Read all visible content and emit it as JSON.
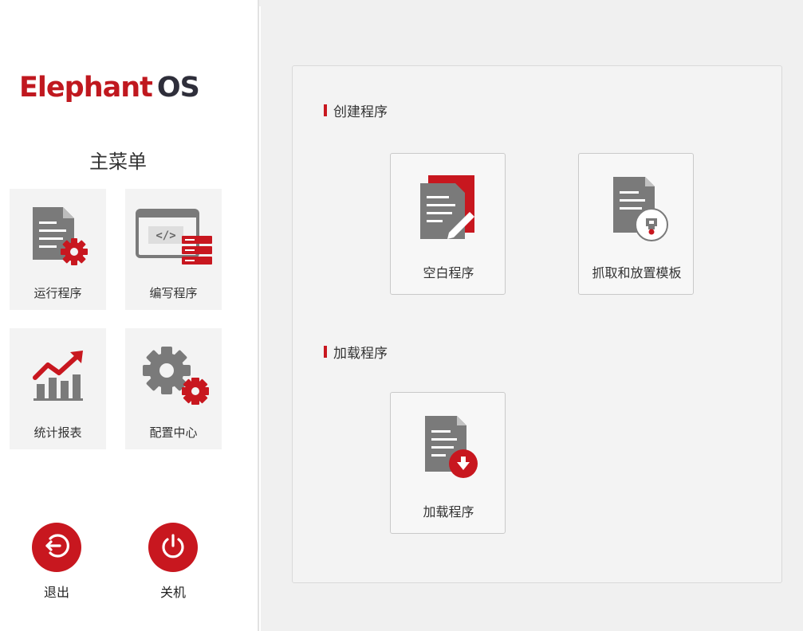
{
  "sidebar": {
    "logo": {
      "part1": "Elephant",
      "part2": "OS"
    },
    "menu_title": "主菜单",
    "tiles": [
      {
        "label": "运行程序",
        "icon": "run-program-icon"
      },
      {
        "label": "编写程序",
        "icon": "code-editor-icon"
      },
      {
        "label": "统计报表",
        "icon": "chart-report-icon"
      },
      {
        "label": "配置中心",
        "icon": "settings-gears-icon"
      }
    ],
    "buttons": [
      {
        "label": "退出",
        "icon": "logout-icon"
      },
      {
        "label": "关机",
        "icon": "power-icon"
      }
    ]
  },
  "main": {
    "sections": [
      {
        "title": "创建程序",
        "cards": [
          {
            "label": "空白程序",
            "icon": "blank-program-icon"
          },
          {
            "label": "抓取和放置模板",
            "icon": "pick-place-template-icon"
          }
        ]
      },
      {
        "title": "加载程序",
        "cards": [
          {
            "label": "加载程序",
            "icon": "load-program-icon"
          }
        ]
      }
    ]
  },
  "colors": {
    "accent": "#c8171f",
    "logo_dark": "#2e2e3a",
    "icon_gray": "#7a7a7a",
    "tile_bg": "#f3f3f3",
    "main_bg": "#f0f0f0"
  }
}
